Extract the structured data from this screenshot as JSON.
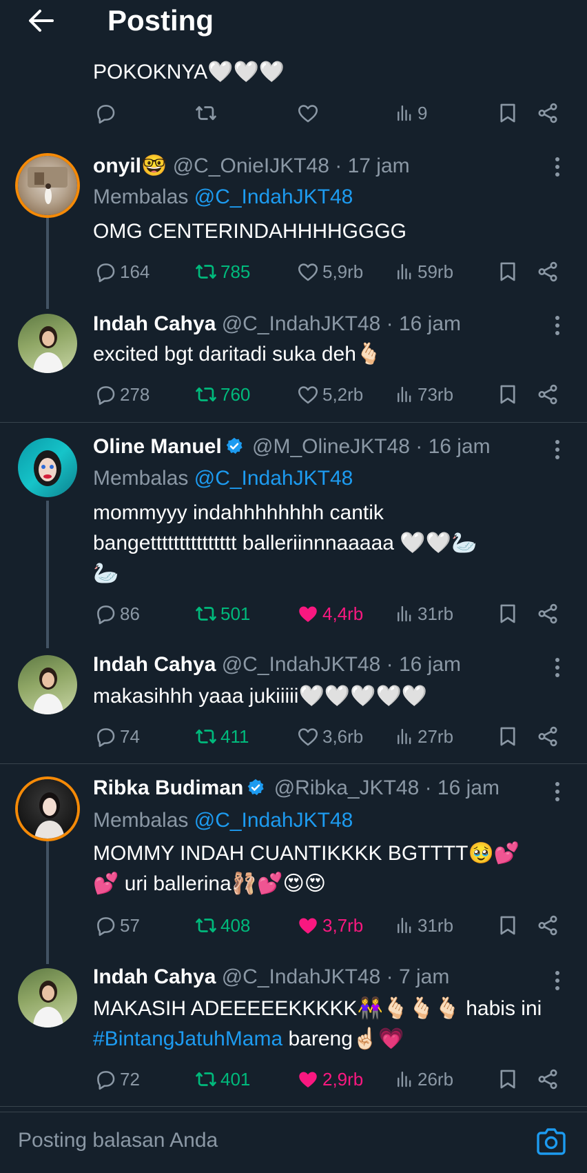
{
  "header": {
    "title": "Posting"
  },
  "top_post": {
    "text": "POKOKNYA🤍🤍🤍",
    "views": "9"
  },
  "posts": [
    {
      "name": "onyil🤓",
      "handle": "@C_OnieIJKT48",
      "time": "· 17 jam",
      "replying_label": "Membalas",
      "replying_to": "@C_IndahJKT48",
      "lines": [
        "OMG CENTERINDAHHHHGGGG"
      ],
      "replies": "164",
      "reposts": "785",
      "likes": "5,9rb",
      "views": "59rb"
    },
    {
      "name": "Indah Cahya",
      "handle": "@C_IndahJKT48",
      "time": "· 16 jam",
      "lines": [
        "excited bgt daritadi suka deh🫰🏻"
      ],
      "replies": "278",
      "reposts": "760",
      "likes": "5,2rb",
      "views": "73rb"
    },
    {
      "name": "Oline Manuel",
      "handle": "@M_OlineJKT48",
      "time": "· 16 jam",
      "replying_label": "Membalas",
      "replying_to": "@C_IndahJKT48",
      "lines": [
        "mommyyy indahhhhhhhh cantik",
        "bangettttttttttttttt balleriinnnaaaaa 🤍🤍🦢",
        "🦢"
      ],
      "replies": "86",
      "reposts": "501",
      "likes": "4,4rb",
      "views": "31rb"
    },
    {
      "name": "Indah Cahya",
      "handle": "@C_IndahJKT48",
      "time": "· 16 jam",
      "lines": [
        "makasihhh yaaa jukiiiii🤍🤍🤍🤍🤍"
      ],
      "replies": "74",
      "reposts": "411",
      "likes": "3,6rb",
      "views": "27rb"
    },
    {
      "name": "Ribka Budiman",
      "handle": "@Ribka_JKT48",
      "time": "· 16 jam",
      "replying_label": "Membalas",
      "replying_to": "@C_IndahJKT48",
      "lines": [
        "MOMMY INDAH CUANTIKKKK BGTTTT🥹💕",
        "💕 uri ballerina🩰💕😍😍"
      ],
      "replies": "57",
      "reposts": "408",
      "likes": "3,7rb",
      "views": "31rb"
    },
    {
      "name": "Indah Cahya",
      "handle": "@C_IndahJKT48",
      "time": "· 7 jam",
      "line1": "MAKASIH ADEEEEEKKKKK👭🫰🏻🫰🏻🫰🏻 habis ini",
      "hashtag": "#BintangJatuhMama",
      "line2_rest": " bareng☝🏻💗",
      "replies": "72",
      "reposts": "401",
      "likes": "2,9rb",
      "views": "26rb"
    }
  ],
  "composer": {
    "placeholder": "Posting balasan Anda"
  },
  "colors": {
    "background": "#15202b",
    "accent": "#1d9bf0",
    "repost": "#00ba7c",
    "like": "#f91880",
    "muted": "#8b98a5"
  }
}
